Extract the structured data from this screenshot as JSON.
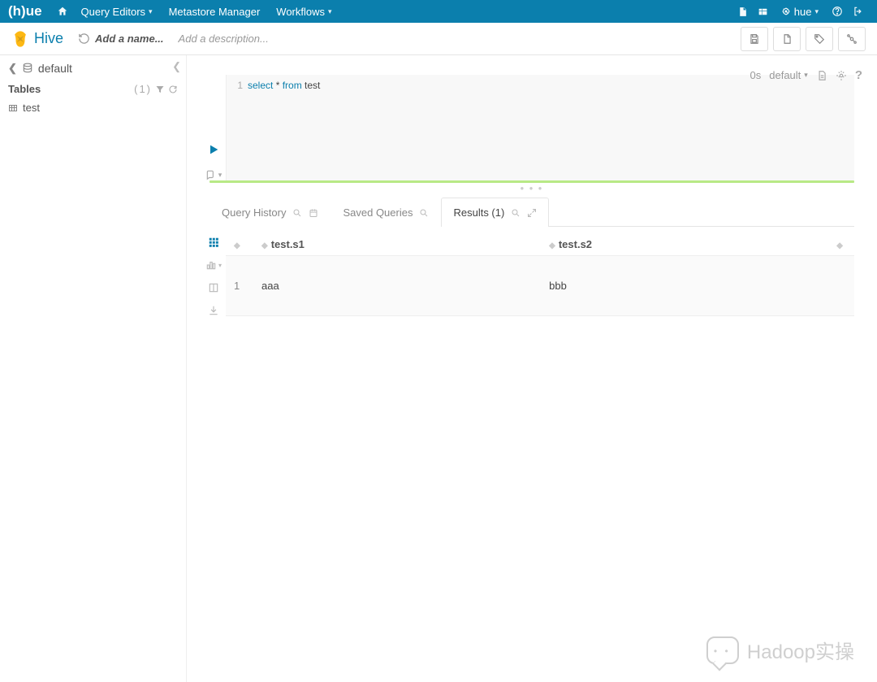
{
  "brand": "HUE",
  "nav": {
    "items": [
      "Query Editors",
      "Metastore Manager",
      "Workflows"
    ],
    "user": "hue"
  },
  "header": {
    "engine": "Hive",
    "add_name_placeholder": "Add a name...",
    "add_desc_placeholder": "Add a description..."
  },
  "sidebar": {
    "database": "default",
    "section": "Tables",
    "count": "(1)",
    "tables": [
      "test"
    ]
  },
  "editor": {
    "status_time": "0s",
    "database": "default",
    "line_no": "1",
    "kw_select": "select",
    "star": " * ",
    "kw_from": "from",
    "ident": " test"
  },
  "tabs": {
    "history": "Query History",
    "saved": "Saved Queries",
    "results": "Results (1)"
  },
  "results": {
    "columns": [
      "test.s1",
      "test.s2"
    ],
    "rows": [
      {
        "idx": "1",
        "c0": "aaa",
        "c1": "bbb"
      }
    ]
  },
  "watermark": "Hadoop实操"
}
